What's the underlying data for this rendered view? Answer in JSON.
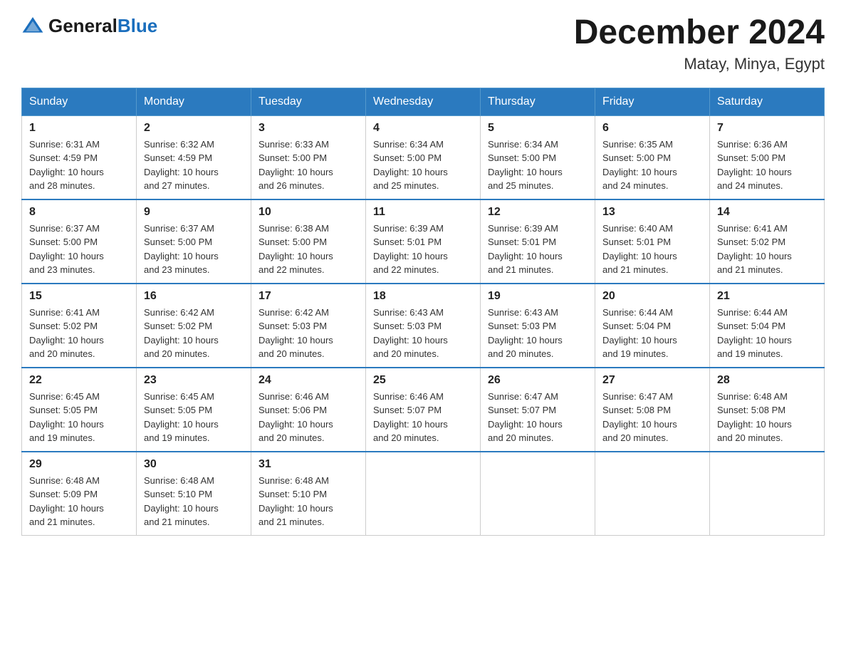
{
  "logo": {
    "text_general": "General",
    "text_blue": "Blue"
  },
  "title": "December 2024",
  "subtitle": "Matay, Minya, Egypt",
  "header_days": [
    "Sunday",
    "Monday",
    "Tuesday",
    "Wednesday",
    "Thursday",
    "Friday",
    "Saturday"
  ],
  "weeks": [
    [
      {
        "day": "1",
        "sunrise": "6:31 AM",
        "sunset": "4:59 PM",
        "daylight": "10 hours and 28 minutes."
      },
      {
        "day": "2",
        "sunrise": "6:32 AM",
        "sunset": "4:59 PM",
        "daylight": "10 hours and 27 minutes."
      },
      {
        "day": "3",
        "sunrise": "6:33 AM",
        "sunset": "5:00 PM",
        "daylight": "10 hours and 26 minutes."
      },
      {
        "day": "4",
        "sunrise": "6:34 AM",
        "sunset": "5:00 PM",
        "daylight": "10 hours and 25 minutes."
      },
      {
        "day": "5",
        "sunrise": "6:34 AM",
        "sunset": "5:00 PM",
        "daylight": "10 hours and 25 minutes."
      },
      {
        "day": "6",
        "sunrise": "6:35 AM",
        "sunset": "5:00 PM",
        "daylight": "10 hours and 24 minutes."
      },
      {
        "day": "7",
        "sunrise": "6:36 AM",
        "sunset": "5:00 PM",
        "daylight": "10 hours and 24 minutes."
      }
    ],
    [
      {
        "day": "8",
        "sunrise": "6:37 AM",
        "sunset": "5:00 PM",
        "daylight": "10 hours and 23 minutes."
      },
      {
        "day": "9",
        "sunrise": "6:37 AM",
        "sunset": "5:00 PM",
        "daylight": "10 hours and 23 minutes."
      },
      {
        "day": "10",
        "sunrise": "6:38 AM",
        "sunset": "5:00 PM",
        "daylight": "10 hours and 22 minutes."
      },
      {
        "day": "11",
        "sunrise": "6:39 AM",
        "sunset": "5:01 PM",
        "daylight": "10 hours and 22 minutes."
      },
      {
        "day": "12",
        "sunrise": "6:39 AM",
        "sunset": "5:01 PM",
        "daylight": "10 hours and 21 minutes."
      },
      {
        "day": "13",
        "sunrise": "6:40 AM",
        "sunset": "5:01 PM",
        "daylight": "10 hours and 21 minutes."
      },
      {
        "day": "14",
        "sunrise": "6:41 AM",
        "sunset": "5:02 PM",
        "daylight": "10 hours and 21 minutes."
      }
    ],
    [
      {
        "day": "15",
        "sunrise": "6:41 AM",
        "sunset": "5:02 PM",
        "daylight": "10 hours and 20 minutes."
      },
      {
        "day": "16",
        "sunrise": "6:42 AM",
        "sunset": "5:02 PM",
        "daylight": "10 hours and 20 minutes."
      },
      {
        "day": "17",
        "sunrise": "6:42 AM",
        "sunset": "5:03 PM",
        "daylight": "10 hours and 20 minutes."
      },
      {
        "day": "18",
        "sunrise": "6:43 AM",
        "sunset": "5:03 PM",
        "daylight": "10 hours and 20 minutes."
      },
      {
        "day": "19",
        "sunrise": "6:43 AM",
        "sunset": "5:03 PM",
        "daylight": "10 hours and 20 minutes."
      },
      {
        "day": "20",
        "sunrise": "6:44 AM",
        "sunset": "5:04 PM",
        "daylight": "10 hours and 19 minutes."
      },
      {
        "day": "21",
        "sunrise": "6:44 AM",
        "sunset": "5:04 PM",
        "daylight": "10 hours and 19 minutes."
      }
    ],
    [
      {
        "day": "22",
        "sunrise": "6:45 AM",
        "sunset": "5:05 PM",
        "daylight": "10 hours and 19 minutes."
      },
      {
        "day": "23",
        "sunrise": "6:45 AM",
        "sunset": "5:05 PM",
        "daylight": "10 hours and 19 minutes."
      },
      {
        "day": "24",
        "sunrise": "6:46 AM",
        "sunset": "5:06 PM",
        "daylight": "10 hours and 20 minutes."
      },
      {
        "day": "25",
        "sunrise": "6:46 AM",
        "sunset": "5:07 PM",
        "daylight": "10 hours and 20 minutes."
      },
      {
        "day": "26",
        "sunrise": "6:47 AM",
        "sunset": "5:07 PM",
        "daylight": "10 hours and 20 minutes."
      },
      {
        "day": "27",
        "sunrise": "6:47 AM",
        "sunset": "5:08 PM",
        "daylight": "10 hours and 20 minutes."
      },
      {
        "day": "28",
        "sunrise": "6:48 AM",
        "sunset": "5:08 PM",
        "daylight": "10 hours and 20 minutes."
      }
    ],
    [
      {
        "day": "29",
        "sunrise": "6:48 AM",
        "sunset": "5:09 PM",
        "daylight": "10 hours and 21 minutes."
      },
      {
        "day": "30",
        "sunrise": "6:48 AM",
        "sunset": "5:10 PM",
        "daylight": "10 hours and 21 minutes."
      },
      {
        "day": "31",
        "sunrise": "6:48 AM",
        "sunset": "5:10 PM",
        "daylight": "10 hours and 21 minutes."
      },
      null,
      null,
      null,
      null
    ]
  ],
  "labels": {
    "sunrise": "Sunrise:",
    "sunset": "Sunset:",
    "daylight": "Daylight:"
  }
}
